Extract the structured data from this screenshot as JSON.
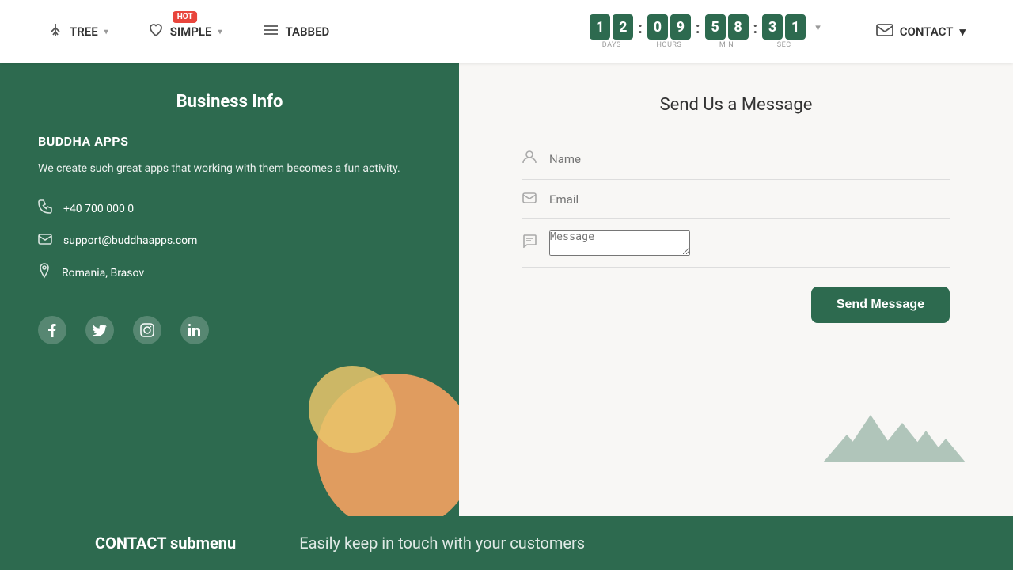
{
  "navbar": {
    "items": [
      {
        "id": "tree",
        "label": "TREE",
        "icon": "⊞",
        "has_chevron": true
      },
      {
        "id": "simple",
        "label": "SIMPLE",
        "icon": "♡",
        "has_chevron": true,
        "hot": true
      },
      {
        "id": "tabbed",
        "label": "TABBED",
        "icon": "☰",
        "has_chevron": false
      }
    ],
    "countdown": {
      "days": [
        "1",
        "2"
      ],
      "hours": [
        "0",
        "9"
      ],
      "minutes": [
        "5",
        "8"
      ],
      "seconds": [
        "3",
        "1"
      ],
      "labels": [
        "DAYS",
        "HOURS",
        "MIN",
        "SEC"
      ]
    },
    "contact": {
      "label": "CONTACT",
      "icon": "✉",
      "has_chevron": true
    }
  },
  "left_panel": {
    "title": "Business Info",
    "company_name": "BUDDHA APPS",
    "description": "We create such great apps that working with them becomes a fun activity.",
    "phone": "+40 700 000 0",
    "email": "support@buddhaapps.com",
    "address": "Romania, Brasov",
    "social": [
      "facebook",
      "twitter",
      "instagram",
      "linkedin"
    ]
  },
  "right_panel": {
    "title": "Send Us a Message",
    "name_placeholder": "Name",
    "email_placeholder": "Email",
    "message_placeholder": "Message",
    "send_button": "Send Message"
  },
  "footer": {
    "main_text": "CONTACT submenu",
    "sub_text": "Easily keep in touch with your customers"
  },
  "icons": {
    "tree": "⊟",
    "heart": "♡",
    "tabbed": "☰",
    "mail": "✉",
    "phone": "📞",
    "envelope": "✉",
    "location": "📍",
    "user": "👤",
    "edit": "✏️",
    "facebook": "f",
    "twitter": "t",
    "instagram": "◎",
    "linkedin": "in",
    "chevron": "▾"
  }
}
